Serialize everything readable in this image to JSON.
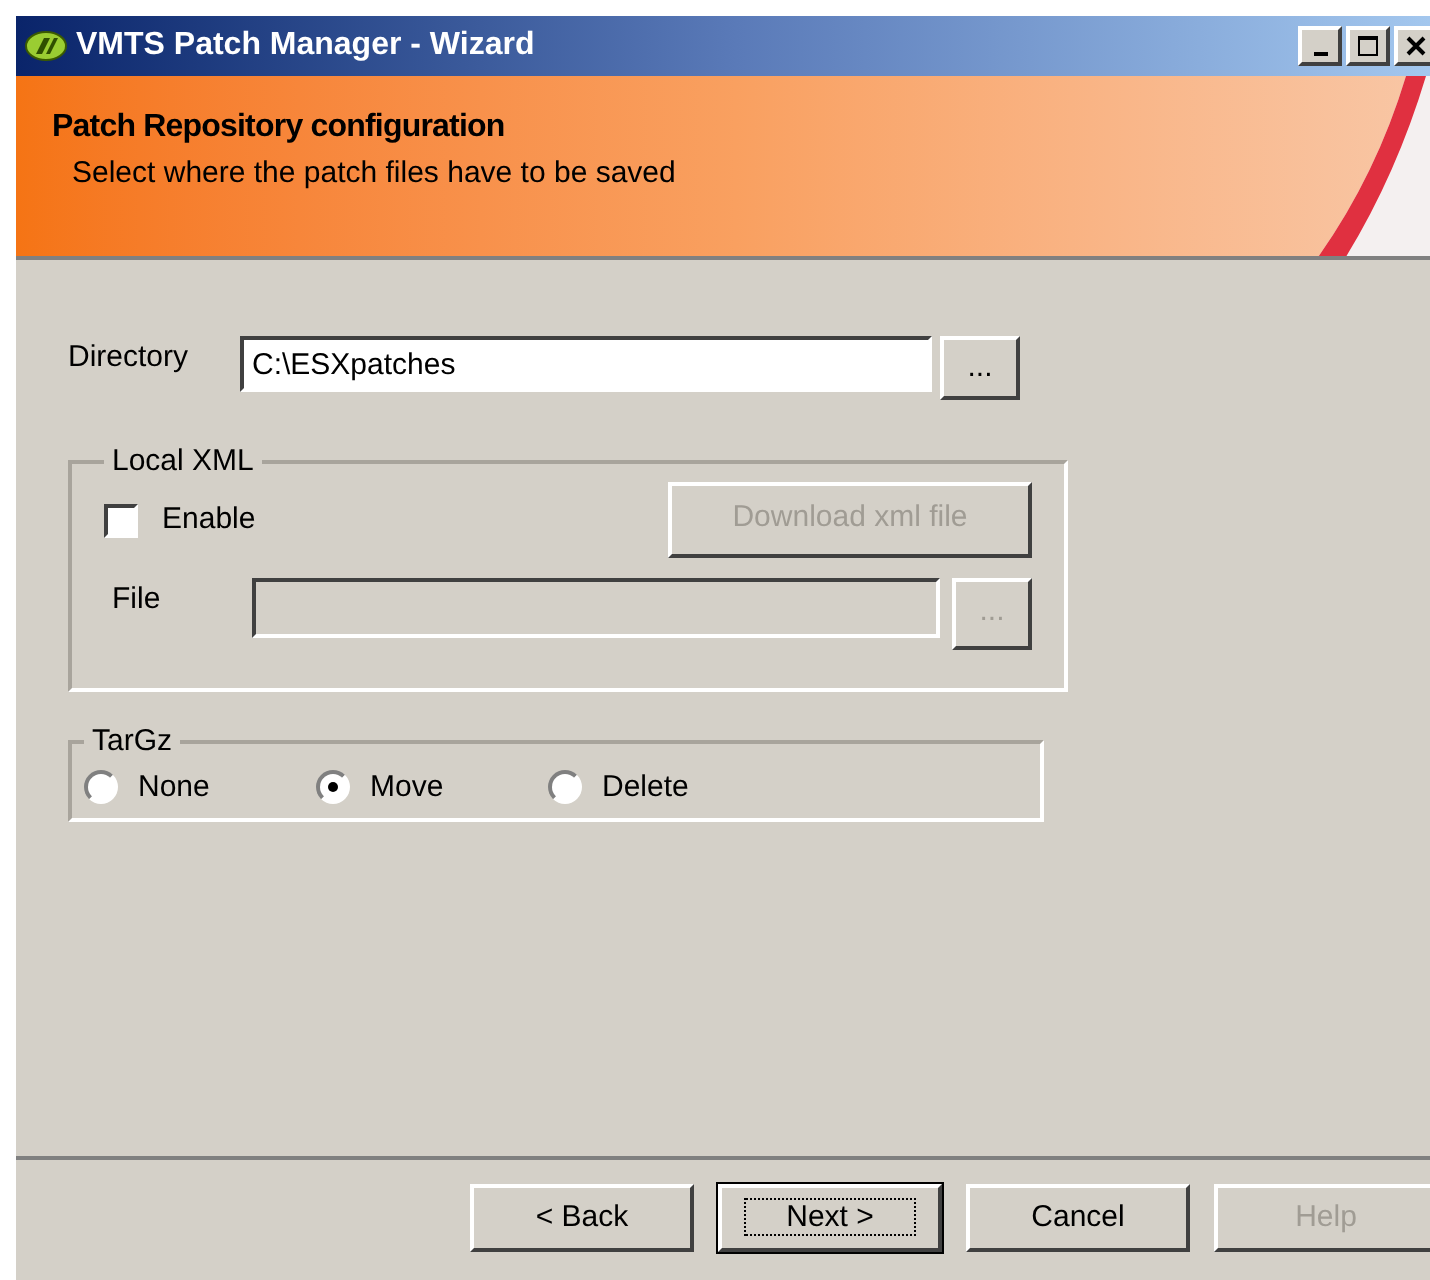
{
  "window": {
    "title": "VMTS Patch Manager - Wizard"
  },
  "header": {
    "title": "Patch Repository configuration",
    "subtitle": "Select where the patch files have to be saved"
  },
  "directory": {
    "label": "Directory",
    "value": "C:\\ESXpatches",
    "browse": "..."
  },
  "local_xml": {
    "legend": "Local XML",
    "enable": {
      "label": "Enable",
      "checked": false
    },
    "download": {
      "label": "Download xml file",
      "disabled": true
    },
    "file": {
      "label": "File",
      "disabled": true,
      "browse": "..."
    }
  },
  "targz": {
    "legend": "TarGz",
    "options": [
      {
        "label": "None",
        "selected": false
      },
      {
        "label": "Move",
        "selected": true
      },
      {
        "label": "Delete",
        "selected": false
      }
    ]
  },
  "buttons": [
    {
      "label": "< Back",
      "disabled": false,
      "default": false
    },
    {
      "label": "Next >",
      "disabled": false,
      "default": true
    },
    {
      "label": "Cancel",
      "disabled": false,
      "default": false
    },
    {
      "label": "Help",
      "disabled": true,
      "default": false
    }
  ]
}
